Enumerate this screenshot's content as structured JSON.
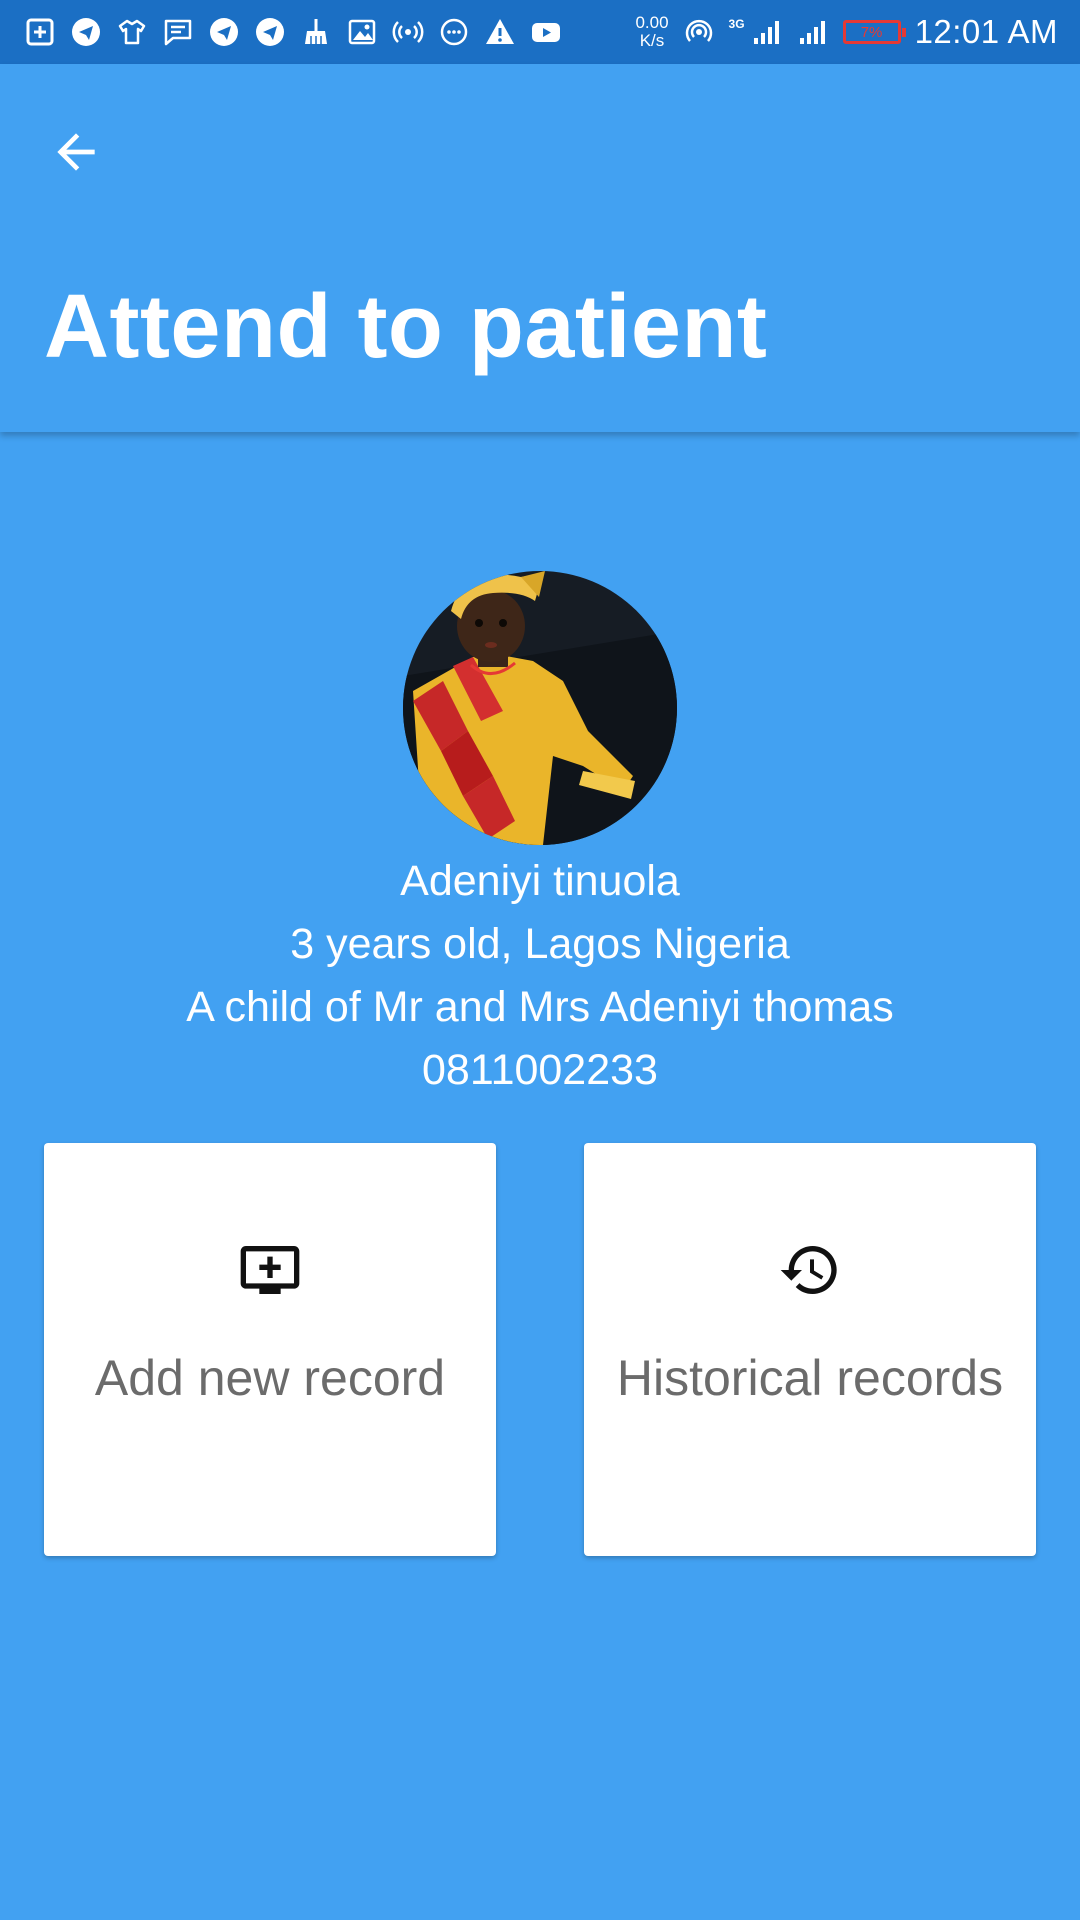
{
  "status_bar": {
    "left_icons": [
      "add-box-icon",
      "telegram-icon",
      "shirt-icon",
      "message-icon",
      "telegram-icon",
      "telegram-icon",
      "broom-icon",
      "image-icon",
      "radio-waves-icon",
      "chat-dots-icon",
      "warning-icon",
      "youtube-icon"
    ],
    "net_speed_value": "0.00",
    "net_speed_unit": "K/s",
    "network_type": "3G",
    "battery_level": "7%",
    "time": "12:01 AM"
  },
  "app_bar": {
    "title": "Attend to patient",
    "back_icon": "arrow-back-icon"
  },
  "patient": {
    "name": "Adeniyi tinuola",
    "age_location": "3 years old, Lagos Nigeria",
    "guardian": "A child of Mr and Mrs Adeniyi thomas",
    "phone": "0811002233"
  },
  "actions": [
    {
      "label": "Add new record",
      "icon": "add-to-queue-icon"
    },
    {
      "label": "Historical records",
      "icon": "history-icon"
    }
  ],
  "colors": {
    "primary": "#42a1f2",
    "status_bar": "#1b6fc4",
    "card_text": "#6b6b6b",
    "battery_low": "#e53935"
  }
}
